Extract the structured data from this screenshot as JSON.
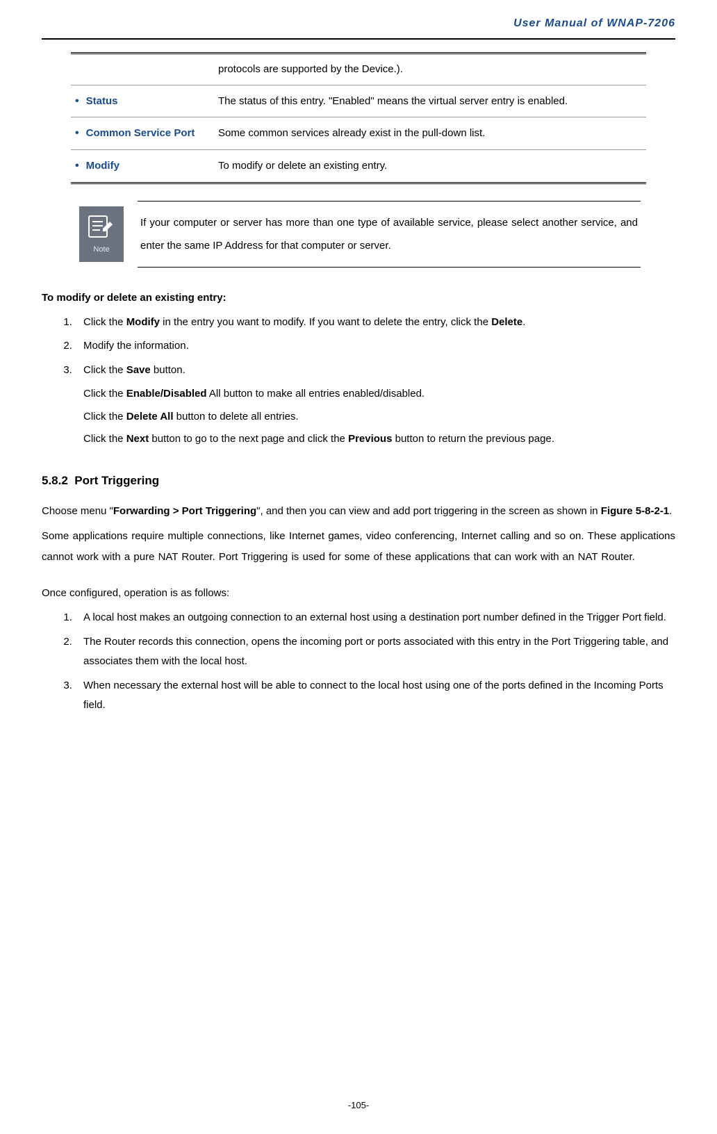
{
  "header": {
    "title": "User Manual of WNAP-7206"
  },
  "table": {
    "rows": [
      {
        "label": "",
        "desc": "protocols are supported by the Device.)."
      },
      {
        "label": "Status",
        "desc": "The status of this entry. \"Enabled\" means the virtual server entry is enabled."
      },
      {
        "label": "Common Service Port",
        "desc": "Some common services already exist in the pull-down list."
      },
      {
        "label": "Modify",
        "desc": "To modify or delete an existing entry."
      }
    ]
  },
  "note": {
    "icon_label": "Note",
    "text": "If your computer or server has more than one type of available service, please select another service, and enter the same IP Address for that computer or server."
  },
  "modify_section": {
    "heading": "To modify or delete an existing entry:",
    "steps": {
      "s1_a": "Click the ",
      "s1_b": "Modify",
      "s1_c": " in the entry you want to modify. If you want to delete the entry, click the ",
      "s1_d": "Delete",
      "s1_e": ".",
      "s2": "Modify the information.",
      "s3_a": "Click the ",
      "s3_b": "Save",
      "s3_c": " button."
    },
    "sub": {
      "l1_a": "Click the ",
      "l1_b": "Enable/Disabled",
      "l1_c": " All button to make all entries enabled/disabled.",
      "l2_a": "Click the ",
      "l2_b": "Delete All",
      "l2_c": " button to delete all entries.",
      "l3_a": "Click the ",
      "l3_b": "Next",
      "l3_c": " button to go to the next page and click the ",
      "l3_d": "Previous",
      "l3_e": " button to return the previous page."
    }
  },
  "subsection": {
    "number": "5.8.2",
    "title": "Port Triggering",
    "p1_a": "Choose menu \"",
    "p1_b": "Forwarding > Port Triggering",
    "p1_c": "\", and then you can view and add port triggering in the screen as shown in ",
    "p1_d": "Figure 5-8-2-1",
    "p1_e": ".",
    "p2": "Some applications require multiple connections, like Internet games, video conferencing, Internet calling and so on. These applications cannot work with a pure NAT Router. Port Triggering is used for some of these applications that can work with an NAT Router.",
    "p3": "Once configured, operation is as follows:",
    "ops": {
      "o1": "A local host makes an outgoing connection to an external host using a destination port number defined in the Trigger Port field.",
      "o2": "The Router records this connection, opens the incoming port or ports associated with this entry in the Port Triggering table, and associates them with the local host.",
      "o3": "When necessary the external host will be able to connect to the local host using one of the ports defined in the Incoming Ports field."
    }
  },
  "footer": {
    "page_number": "-105-"
  }
}
